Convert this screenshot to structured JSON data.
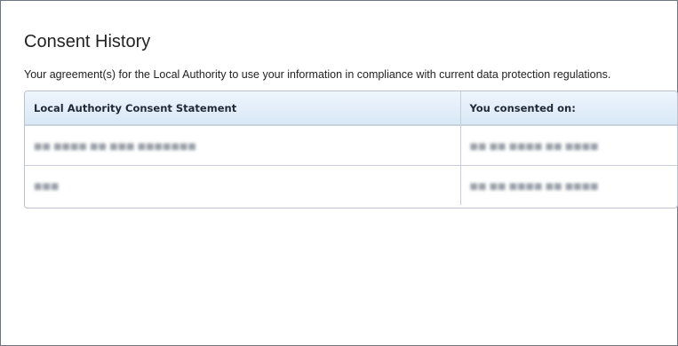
{
  "page": {
    "title": "Consent History",
    "intro": "Your agreement(s) for the Local Authority to use your information in compliance with current data protection regulations."
  },
  "table": {
    "columns": [
      "Local Authority Consent Statement",
      "You consented on:"
    ],
    "rows": [
      {
        "statement": "■■ ■■■■ ■■ ■■■ ■■■■■■■",
        "date": "■■ ■■ ■■■■ ■■ ■■■■"
      },
      {
        "statement": "■■■",
        "date": "■■ ■■ ■■■■ ■■ ■■■■"
      }
    ]
  }
}
